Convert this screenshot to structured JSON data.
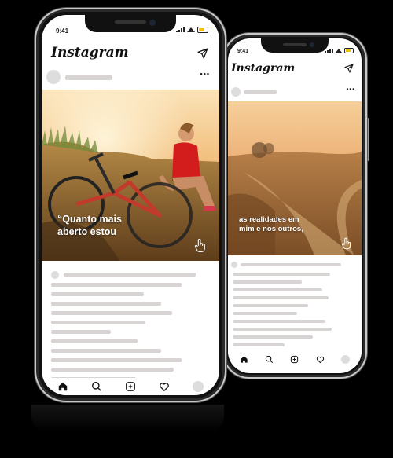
{
  "app": {
    "name": "Instagram"
  },
  "back_phone": {
    "status_time": "9:41",
    "caption_line1": "as realidades em",
    "caption_line2": "mim e nos outros,",
    "icons": [
      "direct-message-icon",
      "more-options-icon",
      "tap-hand-icon",
      "home-icon",
      "search-icon",
      "add-post-icon",
      "heart-icon",
      "profile-icon"
    ]
  },
  "front_phone": {
    "status_time": "9:41",
    "caption_line1": "“Quanto mais",
    "caption_line2": "aberto estou",
    "icons": [
      "direct-message-icon",
      "more-options-icon",
      "tap-hand-icon",
      "home-icon",
      "search-icon",
      "add-post-icon",
      "heart-icon",
      "profile-icon"
    ]
  },
  "colors": {
    "placeholder_bar": "#d9d4d4",
    "battery": "#f2c200",
    "photo_sky": "#f3c58a",
    "photo_field": "#a36a2c",
    "top_blue": "#1d2433"
  }
}
